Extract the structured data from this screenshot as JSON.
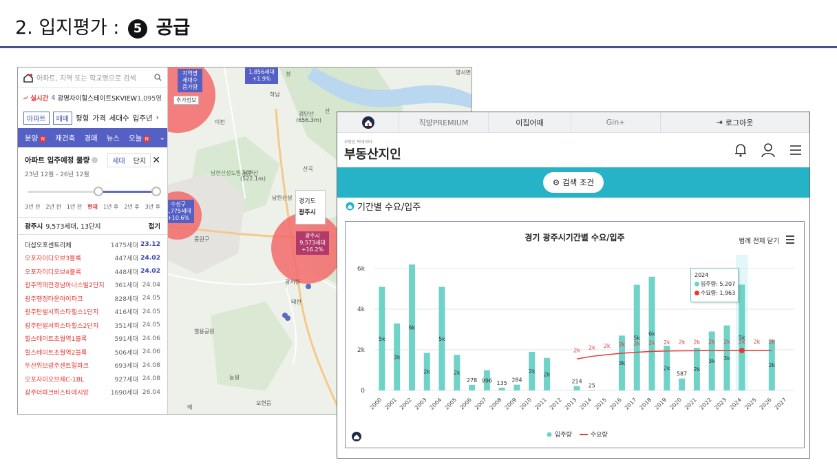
{
  "slide": {
    "title_prefix": "2. 입지평가 :",
    "title_num": "5",
    "title_main": "공급"
  },
  "map": {
    "search_placeholder": "아파트, 지역 또는 학교명으로 검색",
    "realtime_label": "실시간",
    "realtime_rank": "4",
    "realtime_name": "광명자이힐스테이트SKVIEW",
    "realtime_count": "1,095명",
    "chips": [
      "아파트",
      "매매"
    ],
    "filters": [
      "평형",
      "가격",
      "세대수",
      "입주년"
    ],
    "nav": [
      "분양",
      "재건축",
      "경매",
      "뉴스",
      "오늘"
    ],
    "schedule_title": "아파트 입주예정 물량",
    "seg": [
      "세대",
      "단지"
    ],
    "period": "23년 12월 - 26년 12월",
    "slider_labels": [
      "3년 전",
      "2년 전",
      "1년 전",
      "현재",
      "1년 후",
      "2년 후",
      "3년 후"
    ],
    "summary_city": "광주시",
    "summary_detail": "9,573세대, 13단지",
    "fold": "접기",
    "apartments": [
      {
        "name": "더샵오포센트리체",
        "hh": "1475세대",
        "ym": "23.12",
        "red": false,
        "blue": true
      },
      {
        "name": "오포자이디오브3블록",
        "hh": "447세대",
        "ym": "24.02",
        "red": true,
        "blue": true
      },
      {
        "name": "오포자이디오브4블록",
        "hh": "448세대",
        "ym": "24.02",
        "red": true,
        "blue": true
      },
      {
        "name": "광주역태전경남아너스빌2단지",
        "hh": "361세대",
        "ym": "24.04",
        "red": true,
        "blue": false
      },
      {
        "name": "광주행정타운아이파크",
        "hh": "828세대",
        "ym": "24.05",
        "red": true,
        "blue": false
      },
      {
        "name": "광주탄벌서희스타힐스1단지",
        "hh": "416세대",
        "ym": "24.05",
        "red": true,
        "blue": false
      },
      {
        "name": "광주탄벌서희스타힐스2단지",
        "hh": "351세대",
        "ym": "24.05",
        "red": true,
        "blue": false
      },
      {
        "name": "힐스테이트초월역1블록",
        "hh": "591세대",
        "ym": "24.06",
        "red": true,
        "blue": false
      },
      {
        "name": "힐스테이트초월역2블록",
        "hh": "506세대",
        "ym": "24.06",
        "red": true,
        "blue": false
      },
      {
        "name": "두산위브광주센트럴파크",
        "hh": "693세대",
        "ym": "24.08",
        "red": true,
        "blue": false
      },
      {
        "name": "오포자이오브제C-1BL",
        "hh": "927세대",
        "ym": "24.08",
        "red": true,
        "blue": false
      },
      {
        "name": "광주더파크비스타데시앙",
        "hh": "1690세대",
        "ym": "26.04",
        "red": true,
        "blue": false
      }
    ],
    "tag_region_head": "지역명",
    "tag_region": "세대수\n증가량",
    "more_info": "추가정보",
    "tag_top_count": "1,856세대",
    "tag_top_pct": "+1.9%",
    "tag_mid_name": "수성구",
    "tag_mid_count": "1,775세대",
    "tag_mid_pct": "+10.6%",
    "tag_gj_name": "광주시",
    "tag_gj_count": "9,573세대",
    "tag_gj_pct": "+16.2%",
    "popup_region": "경기도",
    "popup_city": "광주시",
    "places": [
      "양서면",
      "하남",
      "검단산",
      "(656.3m)",
      "남한산성도립공원",
      "남한산",
      "(522.1m)",
      "산곡",
      "남한산성",
      "중원구",
      "태전",
      "광지원",
      "열용공원",
      "능원",
      "모현읍",
      "산",
      "성",
      "이천",
      "에"
    ]
  },
  "jiwin": {
    "topnav": [
      "호갱노노",
      "직방PREMIUM",
      "이집어때",
      "Gin+",
      "로그아웃"
    ],
    "brand": "부동산지인",
    "brand_small": "부동산 빅데이터",
    "cond_button": "검색 조건",
    "section_title": "기간별 수요/입주",
    "legend_toggle": "범례 전체 닫기",
    "tooltip_year": "2024",
    "tooltip_supply": "입주량: 5,207",
    "tooltip_demand": "수요량: 1,963",
    "colors": {
      "supply": "#6fd3c8",
      "demand": "#e53935",
      "band": "#26b3c8",
      "nav": "#5560c4"
    }
  },
  "chart_data": {
    "type": "bar",
    "title": "경기 광주시기간별 수요/입주",
    "xlabel": "",
    "ylabel": "",
    "ylim": [
      0,
      6000
    ],
    "yticks": [
      "0",
      "2k",
      "4k",
      "6k"
    ],
    "categories": [
      "2000",
      "2001",
      "2002",
      "2003",
      "2004",
      "2005",
      "2006",
      "2007",
      "2008",
      "2009",
      "2010",
      "2011",
      "2012",
      "2013",
      "2014",
      "2015",
      "2016",
      "2017",
      "2018",
      "2019",
      "2020",
      "2021",
      "2022",
      "2023",
      "2024",
      "2025",
      "2026",
      "2027"
    ],
    "series": [
      {
        "name": "입주량",
        "type": "bar",
        "values": [
          5100,
          3300,
          6200,
          1850,
          5100,
          1750,
          278,
          996,
          135,
          284,
          1900,
          1600,
          0,
          214,
          25,
          0,
          2700,
          5200,
          5600,
          2200,
          587,
          2100,
          2900,
          3200,
          5207,
          0,
          2500,
          0
        ],
        "labels": [
          "5k",
          "3k",
          "6k",
          "2k",
          "5k",
          "2k",
          "278",
          "996",
          "135",
          "284",
          "2k",
          "2k",
          "",
          "214",
          "25",
          "",
          "3k",
          "5k",
          "6k",
          "2k",
          "587",
          "2k",
          "3k",
          "3k",
          "5k",
          "",
          "2k",
          ""
        ]
      },
      {
        "name": "수요량",
        "type": "line",
        "values": [
          null,
          null,
          null,
          null,
          null,
          null,
          null,
          null,
          null,
          null,
          null,
          null,
          null,
          1550,
          1680,
          1760,
          1830,
          1880,
          1920,
          1940,
          1950,
          1955,
          1960,
          1962,
          1963,
          1963,
          1963,
          null
        ],
        "labels": [
          "",
          "",
          "",
          "",
          "",
          "",
          "",
          "",
          "",
          "",
          "",
          "",
          "",
          "2k",
          "2k",
          "2k",
          "2k",
          "2k",
          "2k",
          "2k",
          "2k",
          "2k",
          "2k",
          "2k",
          "2k",
          "2k",
          "2k",
          ""
        ]
      }
    ],
    "legend": [
      "입주량",
      "수요량"
    ],
    "legend_position": "bottom",
    "grid": true
  }
}
